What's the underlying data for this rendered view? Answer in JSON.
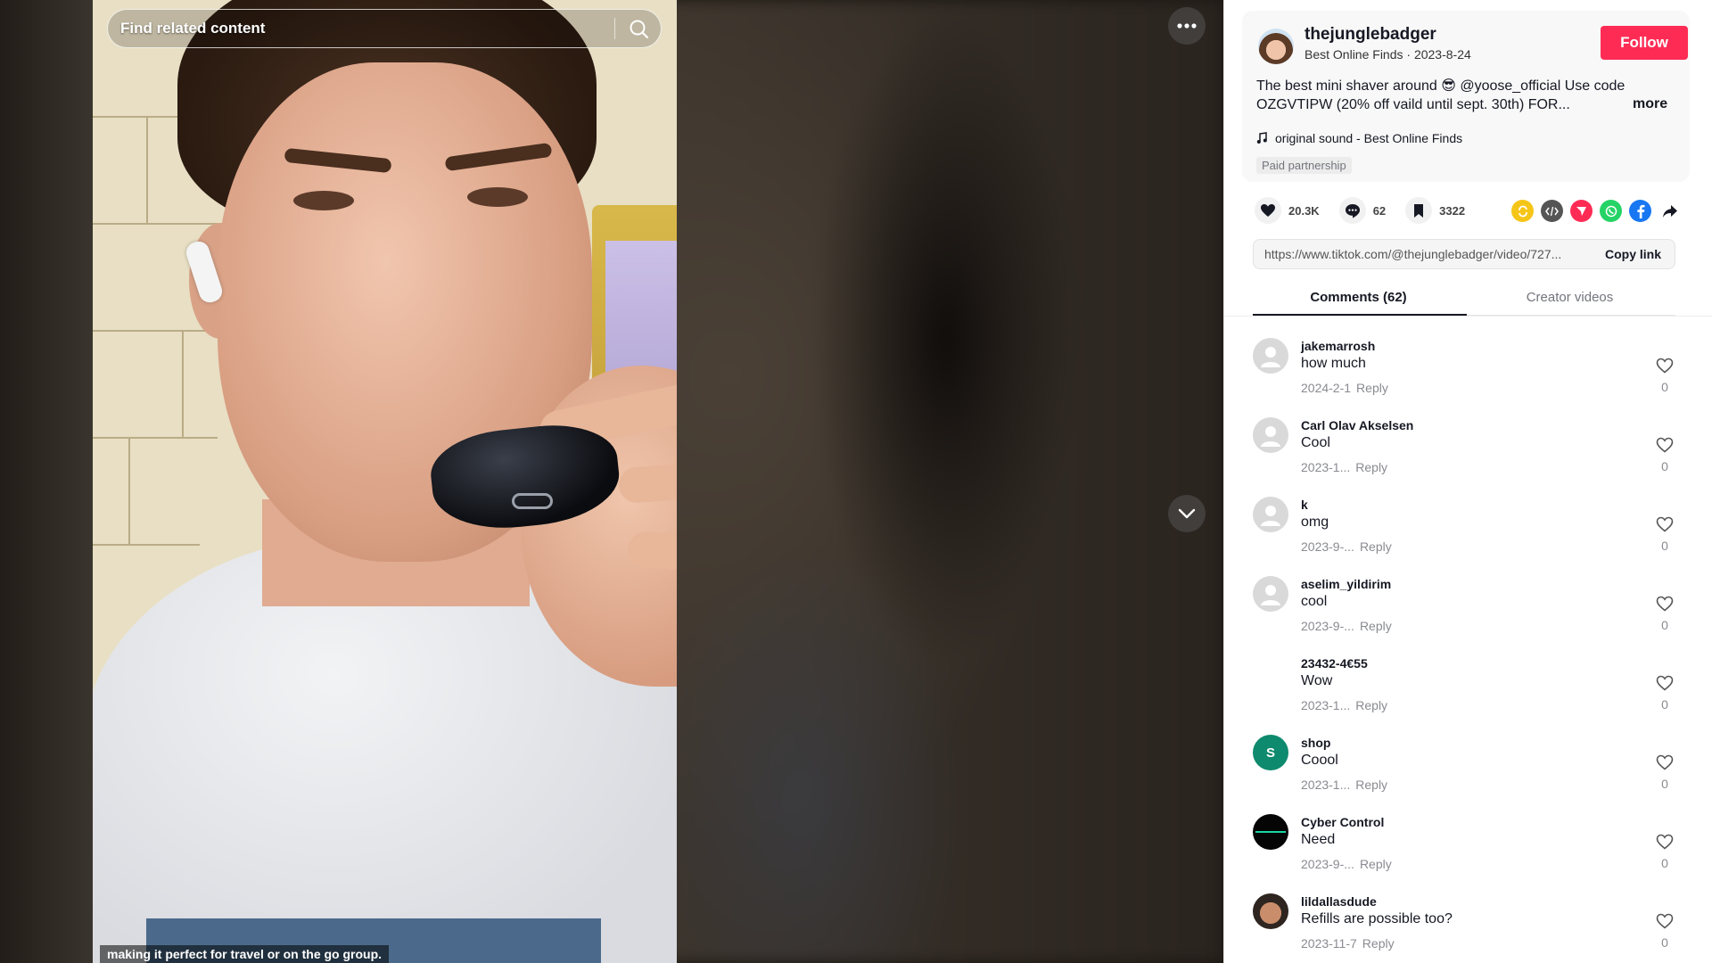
{
  "search": {
    "placeholder": "Find related content"
  },
  "video": {
    "caption": "making it perfect for travel or on the go group."
  },
  "author": {
    "username": "thejunglebadger",
    "nickname": "Best Online Finds",
    "date": "2023-8-24",
    "follow_label": "Follow"
  },
  "post": {
    "description": "The best mini shaver around 😎 @yoose_official Use code OZGVTIPW (20% off vaild until sept. 30th) FOR...",
    "more_label": "more",
    "music": "original sound - Best Online Finds",
    "paid_badge": "Paid partnership"
  },
  "stats": {
    "likes": "20.3K",
    "comments": "62",
    "saves": "3322"
  },
  "share": {
    "icons": [
      "repost-icon",
      "embed-icon",
      "send-icon",
      "whatsapp-icon",
      "facebook-icon",
      "share-arrow-icon"
    ],
    "colors": {
      "repost": "#f5c518",
      "embed": "#555555",
      "send": "#fe2c55",
      "whatsapp": "#25d366",
      "facebook": "#1877f2"
    }
  },
  "link": {
    "url": "https://www.tiktok.com/@thejunglebadger/video/727...",
    "copy_label": "Copy link"
  },
  "tabs": {
    "comments": "Comments (62)",
    "creator_videos": "Creator videos"
  },
  "comments": [
    {
      "user": "jakemarrosh",
      "text": "how much",
      "date": "2024-2-1",
      "reply": "Reply",
      "likes": "0"
    },
    {
      "user": "Carl Olav Akselsen",
      "text": "Cool",
      "date": "2023-1...",
      "reply": "Reply",
      "likes": "0"
    },
    {
      "user": "k",
      "text": "omg",
      "date": "2023-9-...",
      "reply": "Reply",
      "likes": "0"
    },
    {
      "user": "aselim_yildirim",
      "text": "cool",
      "date": "2023-9-...",
      "reply": "Reply",
      "likes": "0"
    },
    {
      "user": "23432-4€55",
      "text": "Wow",
      "date": "2023-1...",
      "reply": "Reply",
      "likes": "0"
    },
    {
      "user": "shop",
      "text": "Coool",
      "date": "2023-1...",
      "reply": "Reply",
      "likes": "0",
      "avatar_letter": "S",
      "avatar_color": "#0e8a6e"
    },
    {
      "user": "Cyber Control",
      "text": "Need",
      "date": "2023-9-...",
      "reply": "Reply",
      "likes": "0"
    },
    {
      "user": "lildallasdude",
      "text": "Refills are possible too?",
      "date": "2023-11-7",
      "reply": "Reply",
      "likes": "0"
    }
  ],
  "colors": {
    "accent": "#fe2c55",
    "text_primary": "#161823",
    "text_secondary": "#8a8b91"
  }
}
